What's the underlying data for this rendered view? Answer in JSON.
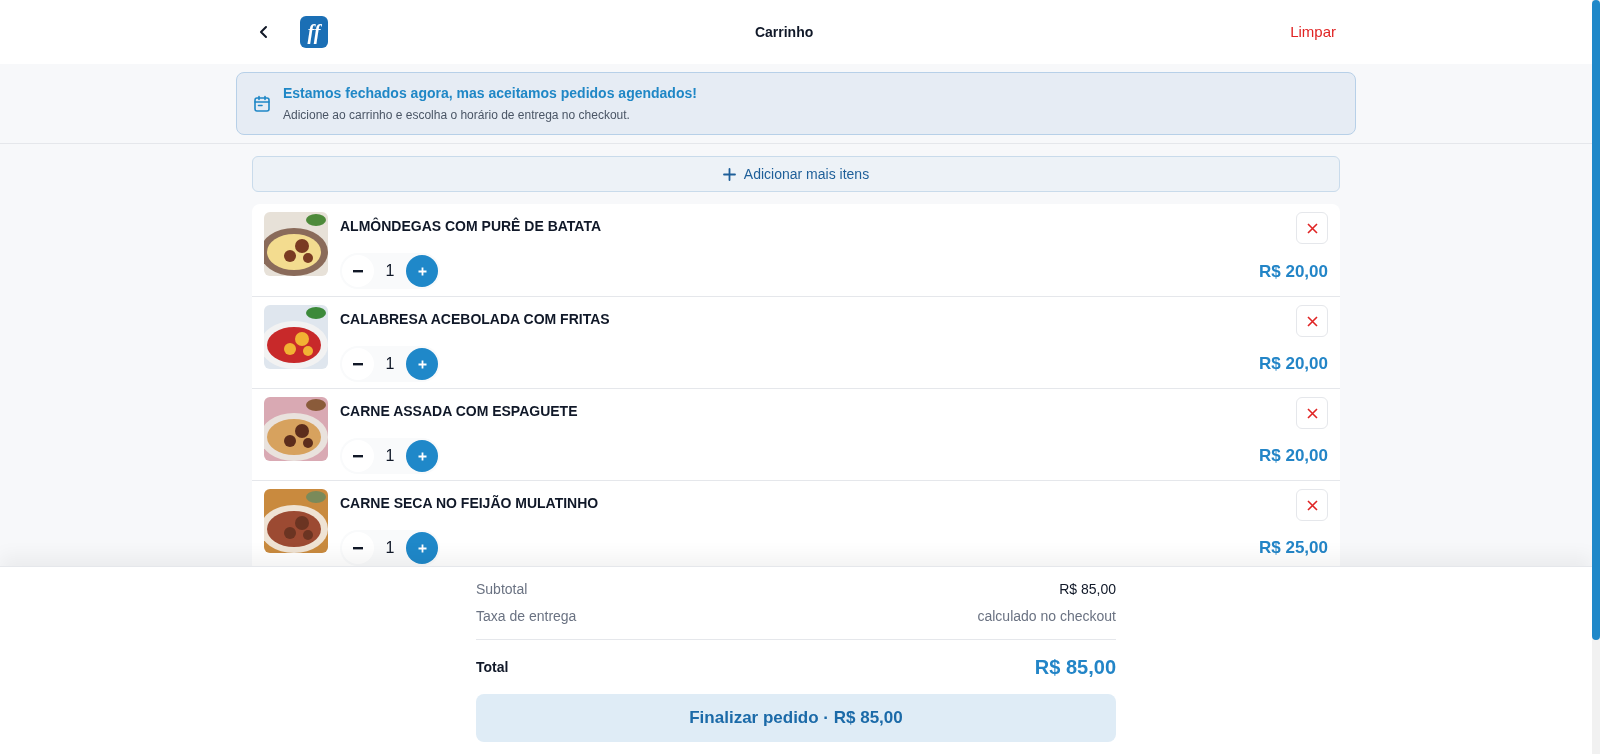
{
  "header": {
    "logo_text": "ff",
    "title": "Carrinho",
    "clear_label": "Limpar"
  },
  "notice": {
    "title": "Estamos fechados agora, mas aceitamos pedidos agendados!",
    "text": "Adicione ao carrinho e escolha o horário de entrega no checkout."
  },
  "add_more": {
    "label": "Adicionar mais itens"
  },
  "items": [
    {
      "name": "ALMÔNDEGAS COM PURÊ DE BATATA",
      "quantity": "1",
      "price": "R$ 20,00"
    },
    {
      "name": "CALABRESA ACEBOLADA COM FRITAS",
      "quantity": "1",
      "price": "R$ 20,00"
    },
    {
      "name": "CARNE ASSADA COM ESPAGUETE",
      "quantity": "1",
      "price": "R$ 20,00"
    },
    {
      "name": "CARNE SECA NO FEIJÃO MULATINHO",
      "quantity": "1",
      "price": "R$ 25,00"
    }
  ],
  "summary": {
    "rows": [
      {
        "label": "Subtotal",
        "value": "R$ 85,00"
      },
      {
        "label": "Taxa de entrega",
        "value": "calculado no checkout"
      }
    ],
    "total_label": "Total",
    "total_value": "R$ 85,00",
    "checkout_label": "Finalizar pedido · R$ 85,00"
  }
}
